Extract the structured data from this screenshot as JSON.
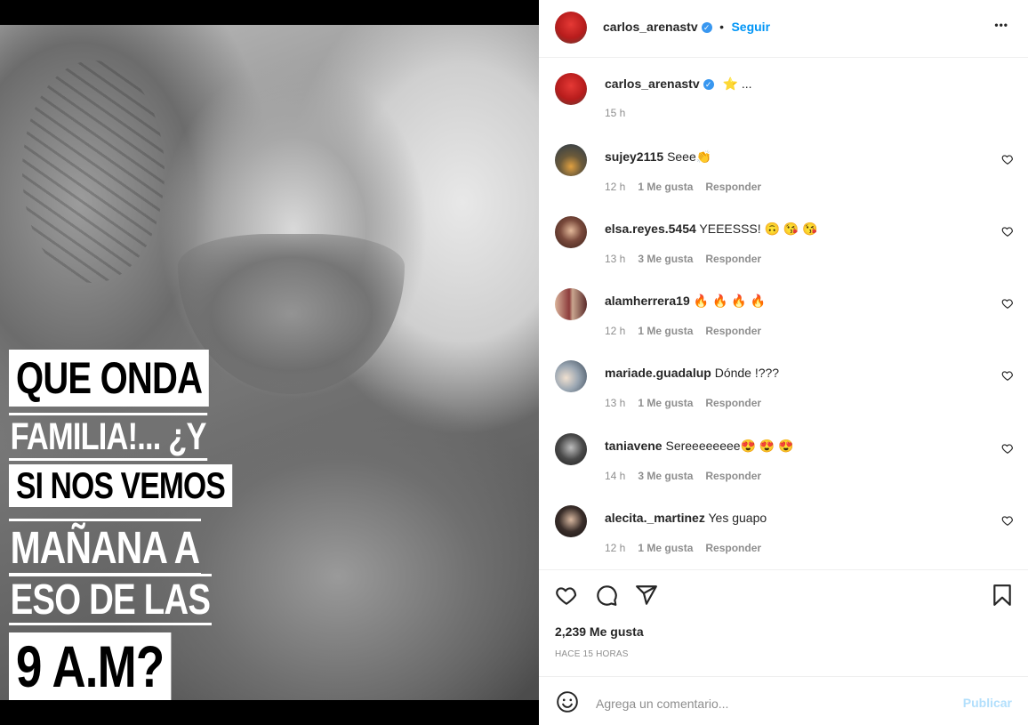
{
  "post": {
    "caption_lines": [
      "QUE ONDA",
      "FAMILIA!... ¿Y",
      "SI NOS VEMOS",
      "MAÑANA A",
      "ESO DE LAS",
      "9 A.M?"
    ]
  },
  "header": {
    "username": "carlos_arenastv",
    "verified_mark": "✓",
    "separator": "•",
    "follow_label": "Seguir",
    "more_label": "•••"
  },
  "owner_comment": {
    "username": "carlos_arenastv",
    "verified_mark": "✓",
    "text": "⭐ ...",
    "time": "15 h"
  },
  "comments": [
    {
      "username": "sujey2115",
      "text": "Seee👏",
      "time": "12 h",
      "likes": "1 Me gusta",
      "reply": "Responder",
      "avatar_color": "#6b5a3a"
    },
    {
      "username": "elsa.reyes.5454",
      "text": "YEEESSS! 🙃 😘 😘",
      "time": "13 h",
      "likes": "3 Me gusta",
      "reply": "Responder",
      "avatar_color": "#7a4a3c"
    },
    {
      "username": "alamherrera19",
      "text": "🔥 🔥 🔥 🔥",
      "time": "12 h",
      "likes": "1 Me gusta",
      "reply": "Responder",
      "avatar_color": "#8c3b3b"
    },
    {
      "username": "mariade.guadalup",
      "text": "Dónde !???",
      "time": "13 h",
      "likes": "1 Me gusta",
      "reply": "Responder",
      "avatar_color": "#5c6b7a"
    },
    {
      "username": "taniavene",
      "text": "Sereeeeeeee😍 😍 😍",
      "time": "14 h",
      "likes": "3 Me gusta",
      "reply": "Responder",
      "avatar_color": "#4a4a4a"
    },
    {
      "username": "alecita._martinez",
      "text": "Yes guapo",
      "time": "12 h",
      "likes": "1 Me gusta",
      "reply": "Responder",
      "avatar_color": "#3a2e2a"
    }
  ],
  "actions": {
    "likes_count": "2,239 Me gusta",
    "time_ago": "HACE 15 HORAS"
  },
  "add_comment": {
    "placeholder": "Agrega un comentario...",
    "publish_label": "Publicar"
  },
  "colors": {
    "accent": "#0095f6",
    "publish_disabled": "#b2dffc",
    "muted": "#8e8e8e",
    "verified": "#3897f0"
  },
  "icons": {
    "like": "heart-icon",
    "comment": "comment-icon",
    "share": "paper-plane-icon",
    "save": "bookmark-icon",
    "emoji": "smiley-icon",
    "more": "more-options-icon"
  }
}
